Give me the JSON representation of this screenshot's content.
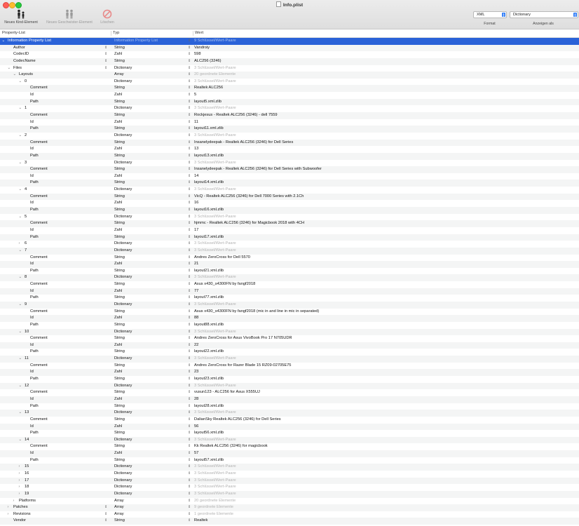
{
  "window": {
    "title": "Info.plist"
  },
  "toolbar": {
    "new_child": "Neues Kind-Element",
    "new_sibling": "Neues Geschwister-Element",
    "delete": "Löschen",
    "format_value": "XML",
    "format_label": "Format",
    "view_value": "Dictionary",
    "view_label": "Anzeigen als"
  },
  "columns": {
    "key": "Property-List",
    "type": "Typ",
    "value": "Wert"
  },
  "rows": [
    {
      "key": "Information Property List",
      "type": "Information Property List",
      "value": "9 Schlüssel/Wert-Paare",
      "level": 0,
      "exp": "open",
      "sel": true,
      "dim": true
    },
    {
      "key": "Author",
      "type": "String",
      "value": "Vandroiy",
      "level": 1,
      "step": true
    },
    {
      "key": "CodecID",
      "type": "Zahl",
      "value": "598",
      "level": 1,
      "step": true
    },
    {
      "key": "CodecName",
      "type": "String",
      "value": "ALC256 (3246)",
      "level": 1,
      "step": true
    },
    {
      "key": "Files",
      "type": "Dictionary",
      "value": "3 Schlüssel/Wert-Paare",
      "level": 1,
      "exp": "open",
      "step": true,
      "dim": true
    },
    {
      "key": "Layouts",
      "type": "Array",
      "value": "20 geordnete Elemente",
      "level": 2,
      "exp": "open",
      "dim": true
    },
    {
      "key": "0",
      "type": "Dictionary",
      "value": "3 Schlüssel/Wert-Paare",
      "level": 3,
      "exp": "open",
      "dim": true
    },
    {
      "key": "Comment",
      "type": "String",
      "value": "Realtek ALC256",
      "level": 4
    },
    {
      "key": "Id",
      "type": "Zahl",
      "value": "5",
      "level": 4
    },
    {
      "key": "Path",
      "type": "String",
      "value": "layout5.xml.zlib",
      "level": 4
    },
    {
      "key": "1",
      "type": "Dictionary",
      "value": "3 Schlüssel/Wert-Paare",
      "level": 3,
      "exp": "open",
      "dim": true
    },
    {
      "key": "Comment",
      "type": "String",
      "value": "Rockjesus - Realtek ALC256 (3246) - dell 7559",
      "level": 4
    },
    {
      "key": "Id",
      "type": "Zahl",
      "value": "11",
      "level": 4
    },
    {
      "key": "Path",
      "type": "String",
      "value": "layout11.xml.zlib",
      "level": 4
    },
    {
      "key": "2",
      "type": "Dictionary",
      "value": "3 Schlüssel/Wert-Paare",
      "level": 3,
      "exp": "open",
      "dim": true
    },
    {
      "key": "Comment",
      "type": "String",
      "value": "Insanelydeepak - Realtek ALC256 (3246) for Dell Series",
      "level": 4
    },
    {
      "key": "Id",
      "type": "Zahl",
      "value": "13",
      "level": 4
    },
    {
      "key": "Path",
      "type": "String",
      "value": "layout13.xml.zlib",
      "level": 4
    },
    {
      "key": "3",
      "type": "Dictionary",
      "value": "3 Schlüssel/Wert-Paare",
      "level": 3,
      "exp": "open",
      "dim": true
    },
    {
      "key": "Comment",
      "type": "String",
      "value": "Insanelydeepak - Realtek ALC256 (3246) for Dell Series with Subwoofer",
      "level": 4
    },
    {
      "key": "Id",
      "type": "Zahl",
      "value": "14",
      "level": 4
    },
    {
      "key": "Path",
      "type": "String",
      "value": "layout14.xml.zlib",
      "level": 4
    },
    {
      "key": "4",
      "type": "Dictionary",
      "value": "3 Schlüssel/Wert-Paare",
      "level": 3,
      "exp": "open",
      "dim": true
    },
    {
      "key": "Comment",
      "type": "String",
      "value": "VicQ - Realtek ALC256 (3246) for Dell 7000 Series with 2.1Ch",
      "level": 4
    },
    {
      "key": "Id",
      "type": "Zahl",
      "value": "16",
      "level": 4
    },
    {
      "key": "Path",
      "type": "String",
      "value": "layout16.xml.zlib",
      "level": 4
    },
    {
      "key": "5",
      "type": "Dictionary",
      "value": "3 Schlüssel/Wert-Paare",
      "level": 3,
      "exp": "open",
      "dim": true
    },
    {
      "key": "Comment",
      "type": "String",
      "value": "hjmmc - Realtek ALC256 (3246) for Magicbook 2018 with 4CH",
      "level": 4
    },
    {
      "key": "Id",
      "type": "Zahl",
      "value": "17",
      "level": 4
    },
    {
      "key": "Path",
      "type": "String",
      "value": "layout17.xml.zlib",
      "level": 4
    },
    {
      "key": "6",
      "type": "Dictionary",
      "value": "3 Schlüssel/Wert-Paare",
      "level": 3,
      "exp": "closed",
      "dim": true
    },
    {
      "key": "7",
      "type": "Dictionary",
      "value": "3 Schlüssel/Wert-Paare",
      "level": 3,
      "exp": "open",
      "dim": true
    },
    {
      "key": "Comment",
      "type": "String",
      "value": "Andres ZeroCross for Dell 5570",
      "level": 4
    },
    {
      "key": "Id",
      "type": "Zahl",
      "value": "21",
      "level": 4
    },
    {
      "key": "Path",
      "type": "String",
      "value": "layout21.xml.zlib",
      "level": 4
    },
    {
      "key": "8",
      "type": "Dictionary",
      "value": "3 Schlüssel/Wert-Paare",
      "level": 3,
      "exp": "open",
      "dim": true
    },
    {
      "key": "Comment",
      "type": "String",
      "value": "Asus x430_s4300FN by fangf2018",
      "level": 4
    },
    {
      "key": "Id",
      "type": "Zahl",
      "value": "77",
      "level": 4
    },
    {
      "key": "Path",
      "type": "String",
      "value": "layout77.xml.zlib",
      "level": 4
    },
    {
      "key": "9",
      "type": "Dictionary",
      "value": "3 Schlüssel/Wert-Paare",
      "level": 3,
      "exp": "open",
      "dim": true
    },
    {
      "key": "Comment",
      "type": "String",
      "value": "Asus x430_s4300FN by fangf2018 (mic in and line in  mic in separated)",
      "level": 4
    },
    {
      "key": "Id",
      "type": "Zahl",
      "value": "88",
      "level": 4
    },
    {
      "key": "Path",
      "type": "String",
      "value": "layout88.xml.zlib",
      "level": 4
    },
    {
      "key": "10",
      "type": "Dictionary",
      "value": "3 Schlüssel/Wert-Paare",
      "level": 3,
      "exp": "open",
      "dim": true
    },
    {
      "key": "Comment",
      "type": "String",
      "value": "Andres ZeroCross for Asus VivoBook Pro 17  N705UDR",
      "level": 4
    },
    {
      "key": "Id",
      "type": "Zahl",
      "value": "22",
      "level": 4
    },
    {
      "key": "Path",
      "type": "String",
      "value": "layout22.xml.zlib",
      "level": 4
    },
    {
      "key": "11",
      "type": "Dictionary",
      "value": "3 Schlüssel/Wert-Paare",
      "level": 3,
      "exp": "open",
      "dim": true
    },
    {
      "key": "Comment",
      "type": "String",
      "value": "Andres ZeroCross for Razer Blade 15 RZ09-02705E75",
      "level": 4
    },
    {
      "key": "Id",
      "type": "Zahl",
      "value": "23",
      "level": 4
    },
    {
      "key": "Path",
      "type": "String",
      "value": "layout23.xml.zlib",
      "level": 4
    },
    {
      "key": "12",
      "type": "Dictionary",
      "value": "3 Schlüssel/Wert-Paare",
      "level": 3,
      "exp": "open",
      "dim": true
    },
    {
      "key": "Comment",
      "type": "String",
      "value": "vusun123 - ALC256 for Asus X555UJ",
      "level": 4
    },
    {
      "key": "Id",
      "type": "Zahl",
      "value": "28",
      "level": 4
    },
    {
      "key": "Path",
      "type": "String",
      "value": "layout28.xml.zlib",
      "level": 4
    },
    {
      "key": "13",
      "type": "Dictionary",
      "value": "3 Schlüssel/Wert-Paare",
      "level": 3,
      "exp": "open",
      "dim": true
    },
    {
      "key": "Comment",
      "type": "String",
      "value": "DalianSky Realtek ALC256 (3246) for Dell Series",
      "level": 4
    },
    {
      "key": "Id",
      "type": "Zahl",
      "value": "56",
      "level": 4
    },
    {
      "key": "Path",
      "type": "String",
      "value": "layout56.xml.zlib",
      "level": 4
    },
    {
      "key": "14",
      "type": "Dictionary",
      "value": "3 Schlüssel/Wert-Paare",
      "level": 3,
      "exp": "open",
      "dim": true
    },
    {
      "key": "Comment",
      "type": "String",
      "value": "Kk Realtek ALC256 (3246) for magicbook",
      "level": 4
    },
    {
      "key": "Id",
      "type": "Zahl",
      "value": "57",
      "level": 4
    },
    {
      "key": "Path",
      "type": "String",
      "value": "layout57.xml.zlib",
      "level": 4
    },
    {
      "key": "15",
      "type": "Dictionary",
      "value": "3 Schlüssel/Wert-Paare",
      "level": 3,
      "exp": "closed",
      "dim": true
    },
    {
      "key": "16",
      "type": "Dictionary",
      "value": "3 Schlüssel/Wert-Paare",
      "level": 3,
      "exp": "closed",
      "dim": true
    },
    {
      "key": "17",
      "type": "Dictionary",
      "value": "3 Schlüssel/Wert-Paare",
      "level": 3,
      "exp": "closed",
      "dim": true
    },
    {
      "key": "18",
      "type": "Dictionary",
      "value": "3 Schlüssel/Wert-Paare",
      "level": 3,
      "exp": "closed",
      "dim": true
    },
    {
      "key": "19",
      "type": "Dictionary",
      "value": "3 Schlüssel/Wert-Paare",
      "level": 3,
      "exp": "closed",
      "dim": true
    },
    {
      "key": "Platforms",
      "type": "Array",
      "value": "20 geordnete Elemente",
      "level": 2,
      "exp": "closed",
      "dim": true
    },
    {
      "key": "Patches",
      "type": "Array",
      "value": "9 geordnete Elemente",
      "level": 1,
      "exp": "closed",
      "step": true,
      "dim": true
    },
    {
      "key": "Revisions",
      "type": "Array",
      "value": "1 geordnete Elemente",
      "level": 1,
      "exp": "closed",
      "step": true,
      "dim": true
    },
    {
      "key": "Vendor",
      "type": "String",
      "value": "Realtek",
      "level": 1,
      "step": true
    }
  ]
}
